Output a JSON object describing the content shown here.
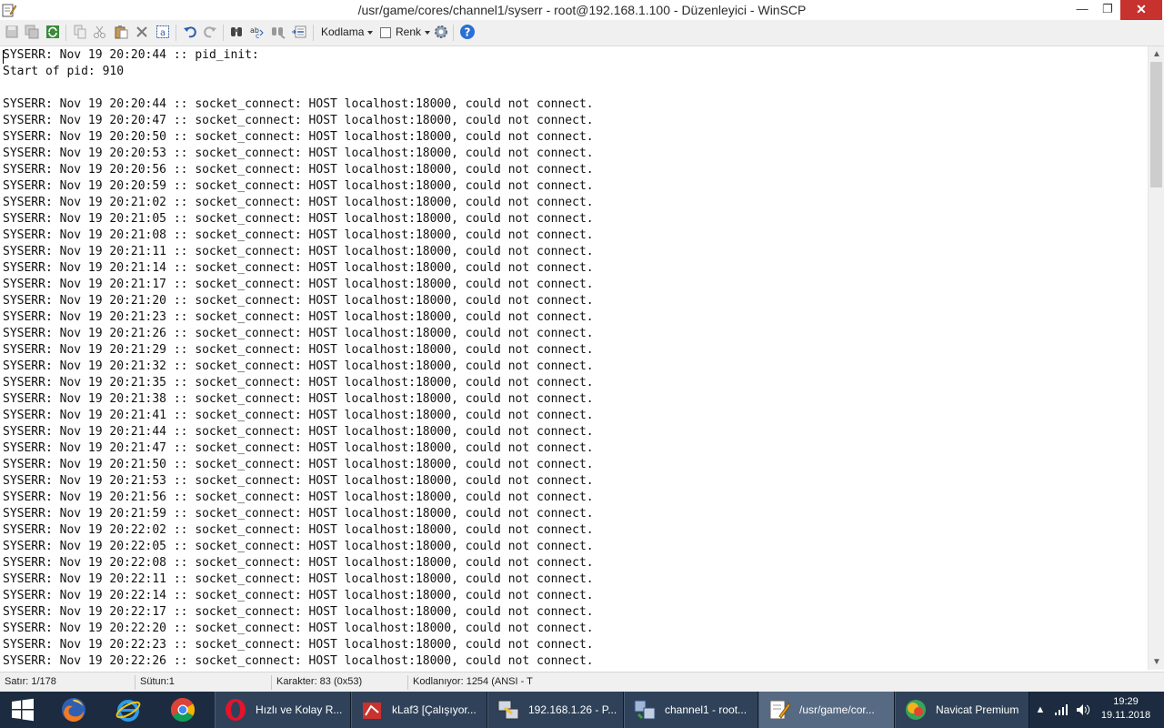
{
  "window": {
    "title": "/usr/game/cores/channel1/syserr - root@192.168.1.100 - Düzenleyici - WinSCP",
    "min": "—",
    "max": "❐",
    "close": "✕"
  },
  "toolbar": {
    "encoding_label": "Kodlama",
    "color_label": "Renk"
  },
  "editor": {
    "lines": [
      "SYSERR: Nov 19 20:20:44 :: pid_init:",
      "Start of pid: 910",
      "",
      "SYSERR: Nov 19 20:20:44 :: socket_connect: HOST localhost:18000, could not connect.",
      "SYSERR: Nov 19 20:20:47 :: socket_connect: HOST localhost:18000, could not connect.",
      "SYSERR: Nov 19 20:20:50 :: socket_connect: HOST localhost:18000, could not connect.",
      "SYSERR: Nov 19 20:20:53 :: socket_connect: HOST localhost:18000, could not connect.",
      "SYSERR: Nov 19 20:20:56 :: socket_connect: HOST localhost:18000, could not connect.",
      "SYSERR: Nov 19 20:20:59 :: socket_connect: HOST localhost:18000, could not connect.",
      "SYSERR: Nov 19 20:21:02 :: socket_connect: HOST localhost:18000, could not connect.",
      "SYSERR: Nov 19 20:21:05 :: socket_connect: HOST localhost:18000, could not connect.",
      "SYSERR: Nov 19 20:21:08 :: socket_connect: HOST localhost:18000, could not connect.",
      "SYSERR: Nov 19 20:21:11 :: socket_connect: HOST localhost:18000, could not connect.",
      "SYSERR: Nov 19 20:21:14 :: socket_connect: HOST localhost:18000, could not connect.",
      "SYSERR: Nov 19 20:21:17 :: socket_connect: HOST localhost:18000, could not connect.",
      "SYSERR: Nov 19 20:21:20 :: socket_connect: HOST localhost:18000, could not connect.",
      "SYSERR: Nov 19 20:21:23 :: socket_connect: HOST localhost:18000, could not connect.",
      "SYSERR: Nov 19 20:21:26 :: socket_connect: HOST localhost:18000, could not connect.",
      "SYSERR: Nov 19 20:21:29 :: socket_connect: HOST localhost:18000, could not connect.",
      "SYSERR: Nov 19 20:21:32 :: socket_connect: HOST localhost:18000, could not connect.",
      "SYSERR: Nov 19 20:21:35 :: socket_connect: HOST localhost:18000, could not connect.",
      "SYSERR: Nov 19 20:21:38 :: socket_connect: HOST localhost:18000, could not connect.",
      "SYSERR: Nov 19 20:21:41 :: socket_connect: HOST localhost:18000, could not connect.",
      "SYSERR: Nov 19 20:21:44 :: socket_connect: HOST localhost:18000, could not connect.",
      "SYSERR: Nov 19 20:21:47 :: socket_connect: HOST localhost:18000, could not connect.",
      "SYSERR: Nov 19 20:21:50 :: socket_connect: HOST localhost:18000, could not connect.",
      "SYSERR: Nov 19 20:21:53 :: socket_connect: HOST localhost:18000, could not connect.",
      "SYSERR: Nov 19 20:21:56 :: socket_connect: HOST localhost:18000, could not connect.",
      "SYSERR: Nov 19 20:21:59 :: socket_connect: HOST localhost:18000, could not connect.",
      "SYSERR: Nov 19 20:22:02 :: socket_connect: HOST localhost:18000, could not connect.",
      "SYSERR: Nov 19 20:22:05 :: socket_connect: HOST localhost:18000, could not connect.",
      "SYSERR: Nov 19 20:22:08 :: socket_connect: HOST localhost:18000, could not connect.",
      "SYSERR: Nov 19 20:22:11 :: socket_connect: HOST localhost:18000, could not connect.",
      "SYSERR: Nov 19 20:22:14 :: socket_connect: HOST localhost:18000, could not connect.",
      "SYSERR: Nov 19 20:22:17 :: socket_connect: HOST localhost:18000, could not connect.",
      "SYSERR: Nov 19 20:22:20 :: socket_connect: HOST localhost:18000, could not connect.",
      "SYSERR: Nov 19 20:22:23 :: socket_connect: HOST localhost:18000, could not connect.",
      "SYSERR: Nov 19 20:22:26 :: socket_connect: HOST localhost:18000, could not connect."
    ]
  },
  "scrollbar": {
    "up": "▲",
    "down": "▼"
  },
  "status": {
    "line": "Satır: 1/178",
    "column": "Sütun:1",
    "character": "Karakter: 83 (0x53)",
    "encoding": "Kodlanıyor: 1254  (ANSI - T"
  },
  "taskbar": {
    "tasks": [
      {
        "label": "Hızlı ve Kolay R...",
        "icon": "opera-icon"
      },
      {
        "label": "kLaf3 [Çalışıyor...",
        "icon": "virtualbox-icon"
      },
      {
        "label": "192.168.1.26 - P...",
        "icon": "putty-icon"
      },
      {
        "label": "channel1 - root...",
        "icon": "winscp-icon"
      },
      {
        "label": "/usr/game/cor...",
        "icon": "editor-icon"
      },
      {
        "label": "Navicat Premium",
        "icon": "navicat-icon"
      }
    ],
    "tray_arrow": "▲",
    "time": "19:29",
    "date": "19.11.2018"
  },
  "colors": {
    "taskbar": "#1c2b3f",
    "close_button": "#c7312e",
    "help_icon": "#2a6fd6"
  }
}
